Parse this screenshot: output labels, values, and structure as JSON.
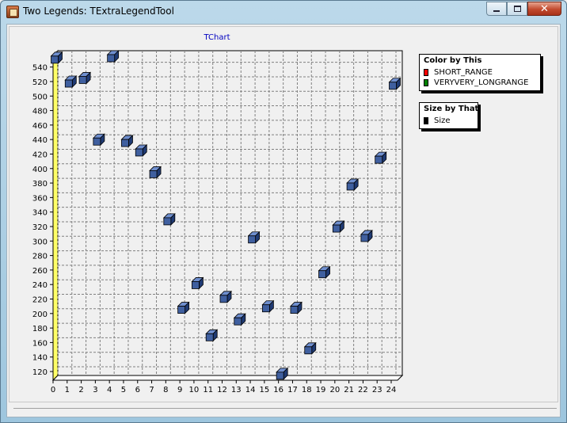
{
  "window": {
    "title": "Two Legends: TExtraLegendTool"
  },
  "caption_buttons": {
    "close_label": "✕"
  },
  "legends": [
    {
      "title": "Color by This",
      "items": [
        {
          "label": "SHORT_RANGE",
          "color": "#ff0000"
        },
        {
          "label": "VERYVERY_LONGRANGE",
          "color": "#008000"
        }
      ]
    },
    {
      "title": "Size by That",
      "items": [
        {
          "label": "Size",
          "color": "#000000"
        }
      ]
    }
  ],
  "chart_data": {
    "type": "scatter",
    "title": "TChart",
    "x": [
      0,
      1,
      2,
      3,
      4,
      5,
      6,
      7,
      8,
      9,
      10,
      11,
      12,
      13,
      14,
      15,
      16,
      17,
      18,
      19,
      20,
      21,
      22,
      23,
      24
    ],
    "y": [
      548,
      515,
      520,
      435,
      550,
      433,
      420,
      390,
      325,
      203,
      237,
      165,
      218,
      187,
      300,
      205,
      112,
      203,
      147,
      252,
      315,
      373,
      302,
      410,
      512
    ],
    "xticks": [
      0,
      1,
      2,
      3,
      4,
      5,
      6,
      7,
      8,
      9,
      10,
      11,
      12,
      13,
      14,
      15,
      16,
      17,
      18,
      19,
      20,
      21,
      22,
      23,
      24
    ],
    "yticks": [
      120,
      140,
      160,
      180,
      200,
      220,
      240,
      260,
      280,
      300,
      320,
      340,
      360,
      380,
      400,
      420,
      440,
      460,
      480,
      500,
      520,
      540
    ],
    "xlim": [
      0,
      24
    ],
    "ylim": [
      108,
      556
    ],
    "grid": true,
    "marker": "cube",
    "colors": {
      "point": "#3f5f9f",
      "point_top": "#6f8fcf",
      "point_side": "#1f3a73",
      "left_wall": "#ffff66",
      "title": "#0000c0",
      "grid": "#808080"
    }
  }
}
